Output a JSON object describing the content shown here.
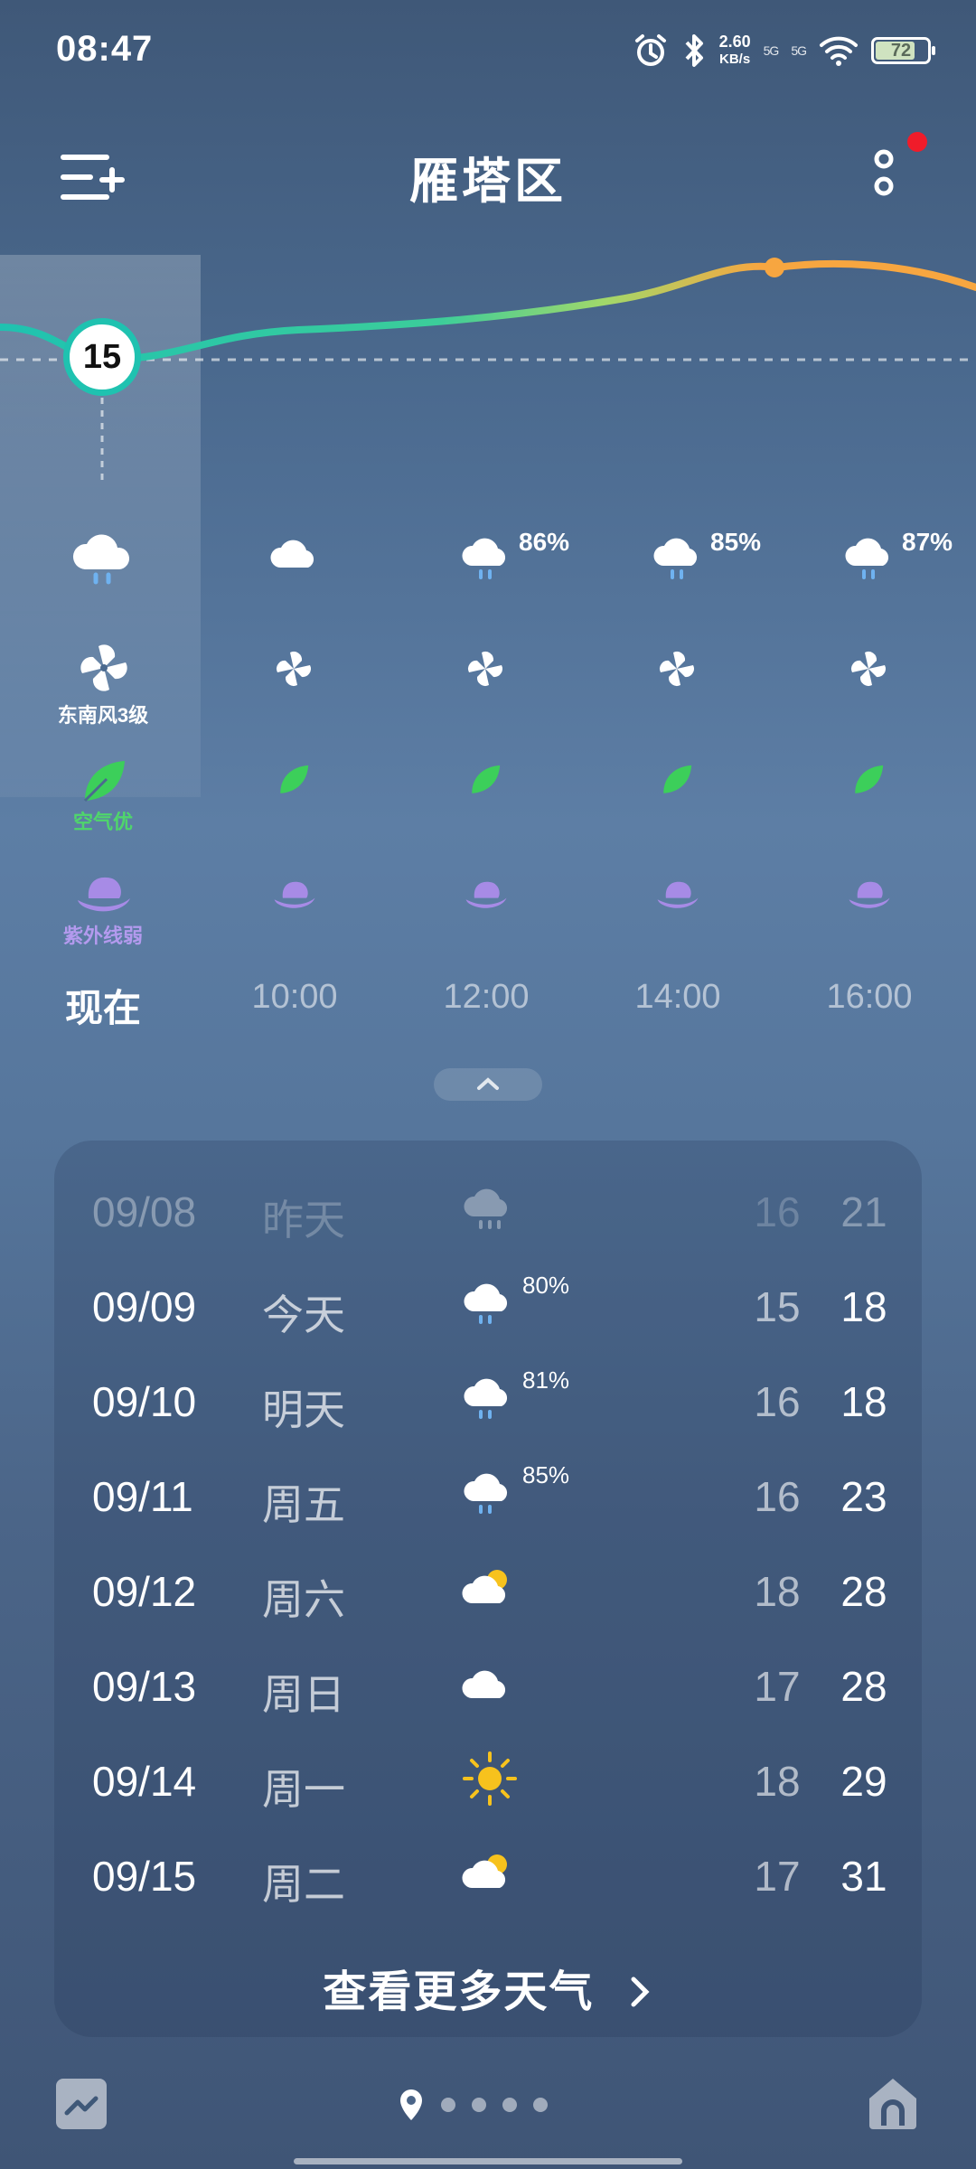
{
  "status_bar": {
    "time": "08:47",
    "net_speed_value": "2.60",
    "net_speed_unit": "KB/s",
    "signal1": "5G",
    "signal2": "5G",
    "battery": "72"
  },
  "header": {
    "title": "雁塔区"
  },
  "hourly": {
    "current_temp": "15",
    "wind_label": "东南风3级",
    "air_label": "空气优",
    "uv_label": "紫外线弱",
    "columns": [
      {
        "time": "现在",
        "weather_icon": "rain-cloud-icon",
        "precip": ""
      },
      {
        "time": "10:00",
        "weather_icon": "cloud-icon",
        "precip": ""
      },
      {
        "time": "12:00",
        "weather_icon": "rain-cloud-icon",
        "precip": "86%"
      },
      {
        "time": "14:00",
        "weather_icon": "rain-cloud-icon",
        "precip": "85%"
      },
      {
        "time": "16:00",
        "weather_icon": "rain-cloud-icon",
        "precip": "87%"
      }
    ]
  },
  "daily": [
    {
      "date": "09/08",
      "day": "昨天",
      "icon": "rain-cloud-icon",
      "precip": "",
      "low": "16",
      "high": "21"
    },
    {
      "date": "09/09",
      "day": "今天",
      "icon": "rain-cloud-icon",
      "precip": "80%",
      "low": "15",
      "high": "18"
    },
    {
      "date": "09/10",
      "day": "明天",
      "icon": "rain-cloud-icon",
      "precip": "81%",
      "low": "16",
      "high": "18"
    },
    {
      "date": "09/11",
      "day": "周五",
      "icon": "rain-cloud-icon",
      "precip": "85%",
      "low": "16",
      "high": "23"
    },
    {
      "date": "09/12",
      "day": "周六",
      "icon": "partly-cloudy-icon",
      "precip": "",
      "low": "18",
      "high": "28"
    },
    {
      "date": "09/13",
      "day": "周日",
      "icon": "cloud-icon",
      "precip": "",
      "low": "17",
      "high": "28"
    },
    {
      "date": "09/14",
      "day": "周一",
      "icon": "sun-icon",
      "precip": "",
      "low": "18",
      "high": "29"
    },
    {
      "date": "09/15",
      "day": "周二",
      "icon": "partly-cloudy-icon",
      "precip": "",
      "low": "17",
      "high": "31"
    }
  ],
  "more_weather": "查看更多天气",
  "colors": {
    "temp_line_start": "#1fc2b0",
    "temp_line_end": "#f7a640",
    "leaf": "#3ccf5a",
    "uv": "#a78be6",
    "sun": "#f7c21d"
  }
}
